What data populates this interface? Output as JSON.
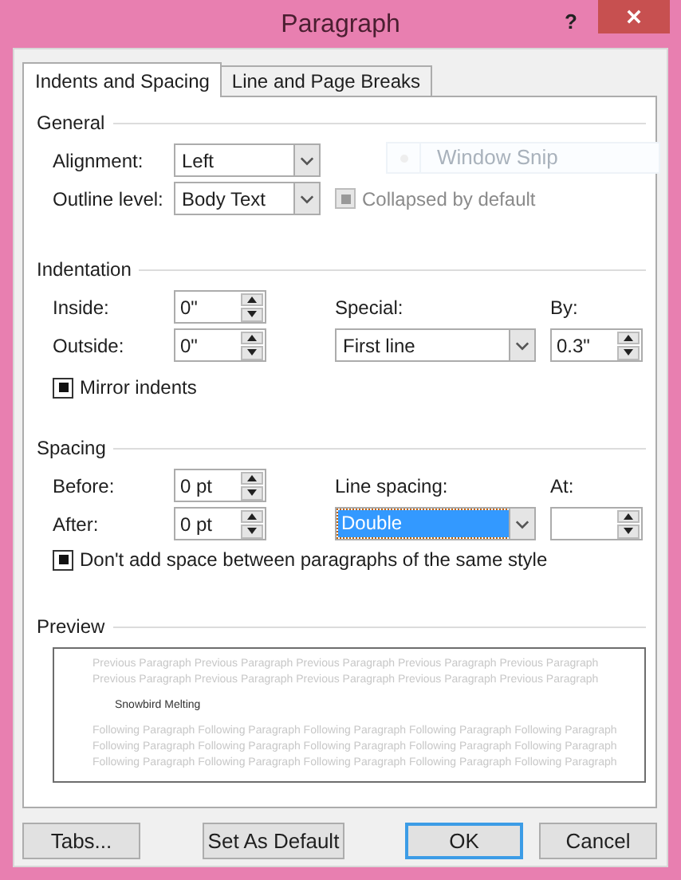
{
  "window": {
    "title": "Paragraph",
    "help": "?"
  },
  "tabs": [
    {
      "label": "Indents and Spacing",
      "selected": true
    },
    {
      "label": "Line and Page Breaks",
      "selected": false
    }
  ],
  "general": {
    "heading": "General",
    "alignment": {
      "label": "Alignment:",
      "value": "Left"
    },
    "outline_level": {
      "label": "Outline level:",
      "value": "Body Text"
    },
    "collapsed_by_default": {
      "label": "Collapsed by default",
      "checked": true,
      "disabled": true
    }
  },
  "overlay": {
    "text": "Window Snip"
  },
  "indentation": {
    "heading": "Indentation",
    "inside": {
      "label": "Inside:",
      "value": "0\""
    },
    "outside": {
      "label": "Outside:",
      "value": "0\""
    },
    "special": {
      "label": "Special:",
      "value": "First line"
    },
    "by": {
      "label": "By:",
      "value": "0.3\""
    },
    "mirror_indents": {
      "label": "Mirror indents",
      "checked": true,
      "disabled": false
    }
  },
  "spacing": {
    "heading": "Spacing",
    "before": {
      "label": "Before:",
      "value": "0 pt"
    },
    "after": {
      "label": "After:",
      "value": "0 pt"
    },
    "line_spacing": {
      "label": "Line spacing:",
      "value": "Double",
      "selected": true
    },
    "at": {
      "label": "At:"
    },
    "dont_add_space": {
      "label": "Don't add space between paragraphs of the same style",
      "checked": true,
      "disabled": false
    }
  },
  "preview": {
    "heading": "Preview",
    "previous_lines": [
      "Previous Paragraph Previous Paragraph Previous Paragraph Previous Paragraph Previous Paragraph",
      "Previous Paragraph Previous Paragraph Previous Paragraph Previous Paragraph Previous Paragraph"
    ],
    "current": "Snowbird Melting",
    "following_lines": [
      "Following Paragraph Following Paragraph Following Paragraph Following Paragraph Following Paragraph",
      "Following Paragraph Following Paragraph Following Paragraph Following Paragraph Following Paragraph",
      "Following Paragraph Following Paragraph Following Paragraph Following Paragraph Following Paragraph"
    ]
  },
  "buttons": [
    {
      "label": "Tabs...",
      "default": false
    },
    {
      "label": "Set As Default",
      "default": false
    },
    {
      "label": "OK",
      "default": true
    },
    {
      "label": "Cancel",
      "default": false
    }
  ]
}
